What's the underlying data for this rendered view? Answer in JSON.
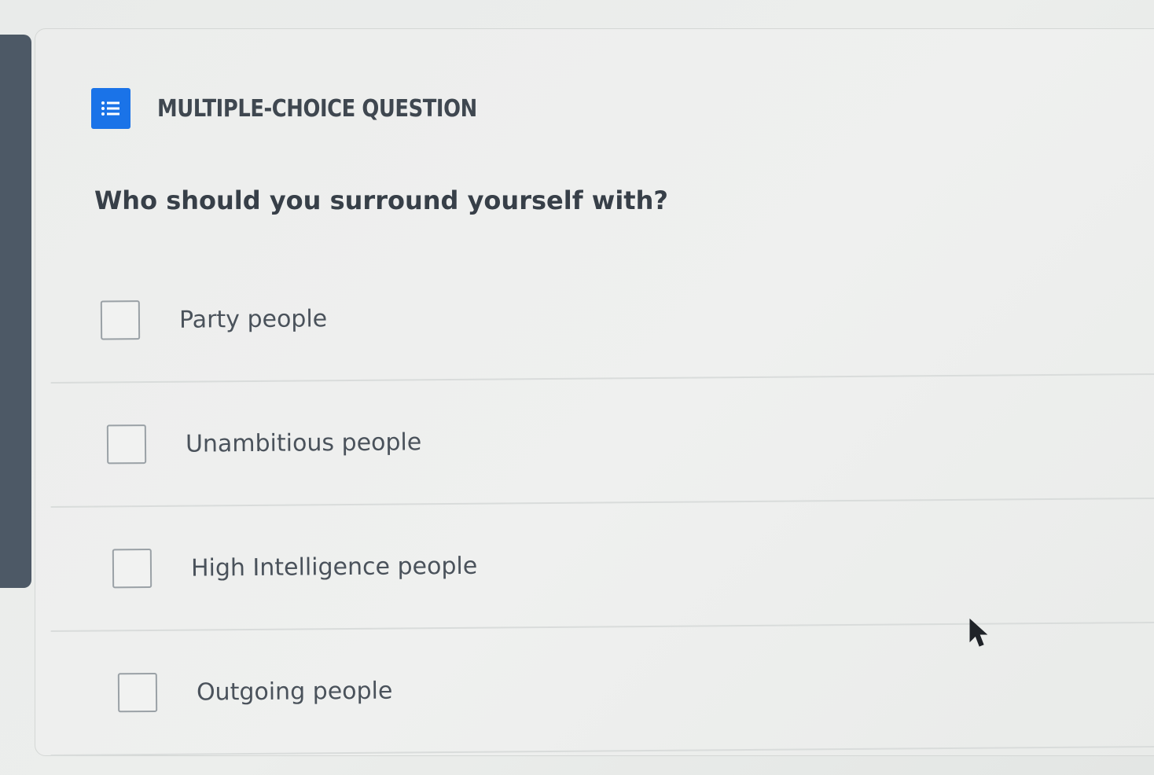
{
  "question_card": {
    "type_label": "MULTIPLE-CHOICE QUESTION",
    "type_icon": "list-icon",
    "question_text": "Who should you surround yourself with?",
    "options": [
      {
        "label": "Party people",
        "checked": false
      },
      {
        "label": "Unambitious people",
        "checked": false
      },
      {
        "label": "High Intelligence people",
        "checked": false
      },
      {
        "label": "Outgoing people",
        "checked": false
      }
    ]
  },
  "colors": {
    "accent": "#1a73e8",
    "text_dark": "#373f48",
    "text_option": "#4a525b",
    "card_bg": "#eeefee",
    "left_strip": "#4d5966"
  }
}
